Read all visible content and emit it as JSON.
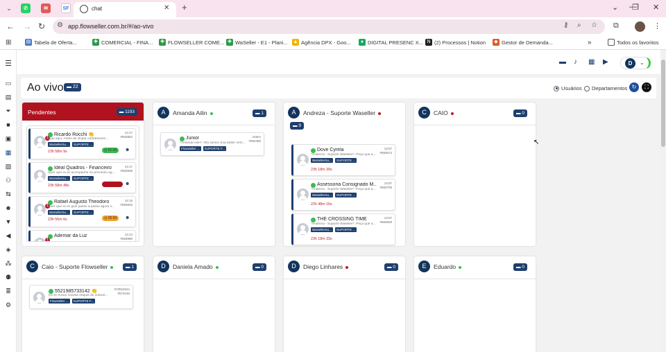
{
  "browser": {
    "tab_title": "chat",
    "pinned_tabs": [
      "WhatsApp",
      "Gmail",
      "SF"
    ],
    "url": "app.flowseller.com.br/#/ao-vivo",
    "new_tab": "+",
    "window_controls": [
      "⌄",
      "—",
      "❐",
      "✕"
    ],
    "bookmarks": [
      {
        "label": "Tabela de Oferta...",
        "color": "#4a78c8"
      },
      {
        "label": "COMERCIAL - FINA...",
        "color": "#2e9a4a"
      },
      {
        "label": "FLOWSELLER COME...",
        "color": "#2e9a4a"
      },
      {
        "label": "WaSeller - E1 - Plani...",
        "color": "#2e9a4a"
      },
      {
        "label": "Agência DPX - Goo...",
        "color": "#f4b400"
      },
      {
        "label": "DIGITAL PRESENC X...",
        "color": "#18a860"
      },
      {
        "label": "(2) Processos | Notion",
        "color": "#222222"
      },
      {
        "label": "Gestor de Demanda...",
        "color": "#e05a2a"
      }
    ],
    "bookmarks_more": "»",
    "all_favorites": "Todos os favoritos"
  },
  "header": {
    "page_title": "Ao vivo",
    "total_count": "22",
    "radio_users": "Usuários",
    "radio_departments": "Departamentos",
    "user_initial": "D"
  },
  "pending": {
    "title": "Pendentes",
    "count": "1193",
    "cards": [
      {
        "name": "Ricardo Rocchi",
        "emoji": "👏",
        "time": "14:17",
        "id": "#583952",
        "preview": "Sejú aqui. Antes de limpar carbaboxies...",
        "tags": [
          "WaSellerSu...",
          "SUPORTE ..."
        ],
        "elapsed": "23h 58m 9s",
        "timer": "01:00",
        "timer_color": "#3cba54",
        "alert": "1"
      },
      {
        "name": "Ideal Quadros - Financeiro",
        "emoji": "",
        "time": "14:17",
        "id": "#583935",
        "preview": "Quer que eu te acompanhe no processo ag...",
        "tags": [
          "WaSellerSu...",
          "SUPORTE ..."
        ],
        "elapsed": "23h 58m 48s",
        "timer": "",
        "timer_color": "#b0121f",
        "alert": ""
      },
      {
        "name": "Rafael Augusto Theodoro",
        "emoji": "",
        "time": "14:15",
        "id": "#583845",
        "preview": "Quer que eu te guie passo a passo agora n...",
        "tags": [
          "WaSellerSu...",
          "SUPORTE ..."
        ],
        "elapsed": "23h 56m 6s",
        "timer": "05:50",
        "timer_color": "#f0a030",
        "alert": "1"
      },
      {
        "name": "Ademar da Luz",
        "emoji": "",
        "time": "14:14",
        "id": "#583895",
        "preview": "",
        "tags": [],
        "elapsed": "",
        "timer": "",
        "timer_color": "",
        "alert": "1"
      }
    ]
  },
  "columns": [
    {
      "initial": "A",
      "name": "Amanda Ailin",
      "status_color": "#3cba54",
      "count": "1",
      "cards": [
        {
          "name": "Junior",
          "meta1": "ontem",
          "meta2": "#362466",
          "preview": "*Amanda Ailin*: Olá Junior, boa tarde! vem...",
          "tags": [
            "FlowSeller ...",
            "SUPORTE F..."
          ],
          "elapsed": ""
        }
      ]
    },
    {
      "initial": "A",
      "name": "Andreza - Suporte Waseller",
      "status_color": "#c0182a",
      "count": "9",
      "cards": [
        {
          "name": "Dove Cyrela",
          "meta1": "13:57",
          "meta2": "#583674",
          "preview": "*Andreza - Suporte Waseller*: Peça que a...",
          "tags": [
            "WaSellerSu...",
            "SUPORTE ..."
          ],
          "elapsed": "23h 18m 39s"
        },
        {
          "name": "Assessoria Consignado M...",
          "meta1": "13:57",
          "meta2": "#583705",
          "preview": "*Andreza - Suporte Waseller*: Peça que a...",
          "tags": [
            "WaSellerSu...",
            "SUPORTE ..."
          ],
          "elapsed": "22h 48m 16s"
        },
        {
          "name": "THE CROSSING TIME",
          "meta1": "13:57",
          "meta2": "#583829",
          "preview": "*Andreza - Suporte Waseller*: Peça que a...",
          "tags": [
            "WaSellerSu...",
            "SUPORTE ..."
          ],
          "elapsed": "23h 18m 33s"
        }
      ]
    },
    {
      "initial": "C",
      "name": "CAIO",
      "status_color": "#c0182a",
      "count": "0",
      "cards": []
    },
    {
      "initial": "C",
      "name": "Caio - Suporte Flowseller",
      "status_color": "#3cba54",
      "count": "1",
      "cards": [
        {
          "name": "5521985733142",
          "emoji": "👏",
          "meta1": "07/05/2024",
          "meta2": "#574246",
          "preview": "Irei te enviar nossas etapas de onboar...",
          "tags": [
            "FlowSeller ...",
            "SUPORTE F..."
          ],
          "elapsed": ""
        }
      ]
    },
    {
      "initial": "D",
      "name": "Daniela Amado",
      "status_color": "#3cba54",
      "count": "0",
      "cards": []
    },
    {
      "initial": "D",
      "name": "Diego Linhares",
      "status_color": "#c0182a",
      "count": "0",
      "cards": []
    },
    {
      "initial": "E",
      "name": "Eduardo",
      "status_color": "#3cba54",
      "count": "0",
      "cards": []
    }
  ]
}
